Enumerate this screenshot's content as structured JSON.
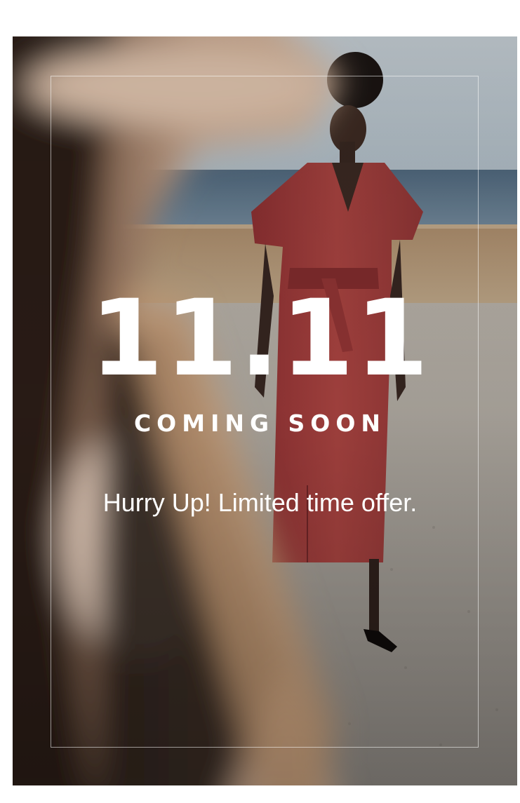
{
  "promo": {
    "headline": "11.11",
    "subheadline": "COMING SOON",
    "tagline": "Hurry Up! Limited time offer."
  },
  "colors": {
    "background": "#ffffff",
    "text": "#ffffff",
    "dress": "#9b3b3c",
    "sea": "#5d7488",
    "sky": "#b9c4cc"
  }
}
